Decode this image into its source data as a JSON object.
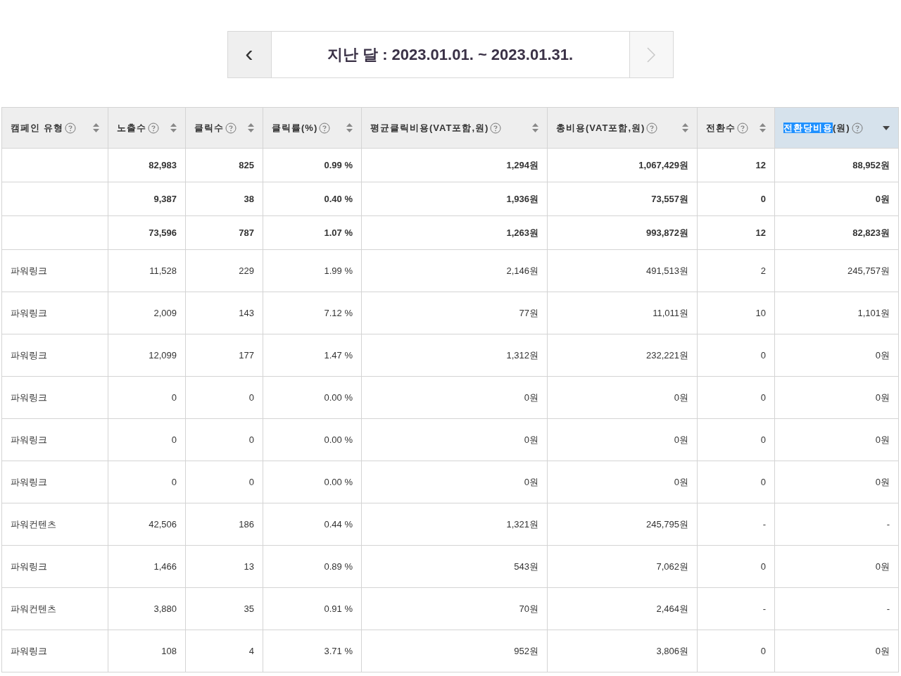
{
  "period_nav": {
    "prev_symbol": "‹",
    "label": "지난 달 : 2023.01.01. ~ 2023.01.31.",
    "next_disabled": true
  },
  "table": {
    "columns": [
      {
        "label": "캠페인 유형",
        "sorted": false
      },
      {
        "label": "노출수",
        "sorted": false
      },
      {
        "label": "클릭수",
        "sorted": false
      },
      {
        "label": "클릭률(%)",
        "sorted": false
      },
      {
        "label": "평균클릭비용(VAT포함,원)",
        "sorted": false
      },
      {
        "label": "총비용(VAT포함,원)",
        "sorted": false
      },
      {
        "label": "전환수",
        "sorted": false
      },
      {
        "label_selected": "전환당비용",
        "label": "(원)",
        "sorted": true
      }
    ],
    "rows": [
      {
        "kind": "summary",
        "cells": [
          "",
          "82,983",
          "825",
          "0.99 %",
          "1,294원",
          "1,067,429원",
          "12",
          "88,952원"
        ]
      },
      {
        "kind": "summary",
        "cells": [
          "",
          "9,387",
          "38",
          "0.40 %",
          "1,936원",
          "73,557원",
          "0",
          "0원"
        ]
      },
      {
        "kind": "summary",
        "cells": [
          "",
          "73,596",
          "787",
          "1.07 %",
          "1,263원",
          "993,872원",
          "12",
          "82,823원"
        ]
      },
      {
        "kind": "data",
        "cells": [
          "파워링크",
          "11,528",
          "229",
          "1.99 %",
          "2,146원",
          "491,513원",
          "2",
          "245,757원"
        ]
      },
      {
        "kind": "data",
        "cells": [
          "파워링크",
          "2,009",
          "143",
          "7.12 %",
          "77원",
          "11,011원",
          "10",
          "1,101원"
        ]
      },
      {
        "kind": "data",
        "cells": [
          "파워링크",
          "12,099",
          "177",
          "1.47 %",
          "1,312원",
          "232,221원",
          "0",
          "0원"
        ]
      },
      {
        "kind": "data",
        "cells": [
          "파워링크",
          "0",
          "0",
          "0.00 %",
          "0원",
          "0원",
          "0",
          "0원"
        ]
      },
      {
        "kind": "data",
        "cells": [
          "파워링크",
          "0",
          "0",
          "0.00 %",
          "0원",
          "0원",
          "0",
          "0원"
        ]
      },
      {
        "kind": "data",
        "cells": [
          "파워링크",
          "0",
          "0",
          "0.00 %",
          "0원",
          "0원",
          "0",
          "0원"
        ]
      },
      {
        "kind": "data",
        "cells": [
          "파워컨텐츠",
          "42,506",
          "186",
          "0.44 %",
          "1,321원",
          "245,795원",
          "-",
          "-"
        ]
      },
      {
        "kind": "data",
        "cells": [
          "파워링크",
          "1,466",
          "13",
          "0.89 %",
          "543원",
          "7,062원",
          "0",
          "0원"
        ]
      },
      {
        "kind": "data",
        "cells": [
          "파워컨텐츠",
          "3,880",
          "35",
          "0.91 %",
          "70원",
          "2,464원",
          "-",
          "-"
        ]
      },
      {
        "kind": "data",
        "cells": [
          "파워링크",
          "108",
          "4",
          "3.71 %",
          "952원",
          "3,806원",
          "0",
          "0원"
        ]
      }
    ]
  }
}
